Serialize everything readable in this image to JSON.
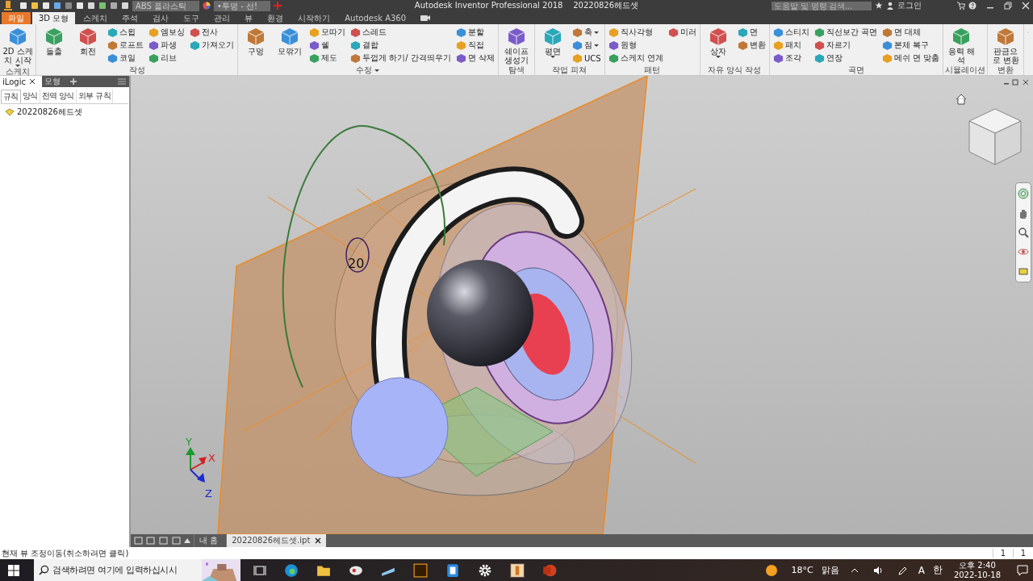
{
  "title_bar": {
    "material": "ABS 플라스틱",
    "appearance": "•투명 - 선!",
    "title": "Autodesk Inventor Professional 2018",
    "document": "20220826헤드셋",
    "search": {
      "placeholder": "도움말 및 명령 검색..."
    },
    "login": "로그인"
  },
  "tabs": [
    {
      "label": "파일",
      "kind": "file",
      "selected": false
    },
    {
      "label": "3D 모형",
      "kind": "tab",
      "selected": true
    },
    {
      "label": "스케치",
      "kind": "tab",
      "selected": false
    },
    {
      "label": "주석",
      "kind": "tab",
      "selected": false
    },
    {
      "label": "검사",
      "kind": "tab",
      "selected": false
    },
    {
      "label": "도구",
      "kind": "tab",
      "selected": false
    },
    {
      "label": "관리",
      "kind": "tab",
      "selected": false
    },
    {
      "label": "뷰",
      "kind": "tab",
      "selected": false
    },
    {
      "label": "환경",
      "kind": "tab",
      "selected": false
    },
    {
      "label": "시작하기",
      "kind": "tab",
      "selected": false
    },
    {
      "label": "Autodesk A360",
      "kind": "tab",
      "selected": false
    }
  ],
  "ribbon": [
    {
      "title": "스케치",
      "items": [
        {
          "label": "2D 스케치 시작",
          "kind": "large",
          "dropdown": true
        }
      ]
    },
    {
      "title": "작성",
      "items": [
        {
          "label": "돌출",
          "kind": "large"
        },
        {
          "label": "회전",
          "kind": "large"
        },
        {
          "label": "스윕",
          "kind": "small"
        },
        {
          "label": "로프트",
          "kind": "small"
        },
        {
          "label": "코일",
          "kind": "small"
        },
        {
          "label": "엠보싱",
          "kind": "small"
        },
        {
          "label": "파생",
          "kind": "small"
        },
        {
          "label": "리브",
          "kind": "small"
        },
        {
          "label": "전사",
          "kind": "small"
        },
        {
          "label": "가져오기",
          "kind": "small"
        }
      ]
    },
    {
      "title": "수정",
      "expandable": true,
      "items": [
        {
          "label": "구멍",
          "kind": "large"
        },
        {
          "label": "모깎기",
          "kind": "large"
        },
        {
          "label": "모따기",
          "kind": "small"
        },
        {
          "label": "쉘",
          "kind": "small"
        },
        {
          "label": "제도",
          "kind": "small"
        },
        {
          "label": "스레드",
          "kind": "small"
        },
        {
          "label": "결합",
          "kind": "small"
        },
        {
          "label": "두껍게 하기/ 간격띄우기",
          "kind": "small"
        },
        {
          "label": "분할",
          "kind": "small"
        },
        {
          "label": "직접",
          "kind": "small"
        },
        {
          "label": "면 삭제",
          "kind": "small"
        }
      ]
    },
    {
      "title": "탐색",
      "items": [
        {
          "label": "쉐이프 생성기",
          "kind": "large"
        }
      ]
    },
    {
      "title": "작업 피쳐",
      "items": [
        {
          "label": "평면",
          "kind": "large",
          "dropdown": true
        },
        {
          "label": "축",
          "kind": "small",
          "dropdown": true
        },
        {
          "label": "점",
          "kind": "small",
          "dropdown": true
        },
        {
          "label": "UCS",
          "kind": "small"
        }
      ]
    },
    {
      "title": "패턴",
      "items": [
        {
          "label": "직사각형",
          "kind": "small"
        },
        {
          "label": "원형",
          "kind": "small"
        },
        {
          "label": "스케치 연계",
          "kind": "small"
        },
        {
          "label": "미러",
          "kind": "small"
        }
      ]
    },
    {
      "title": "자유 양식 작성",
      "items": [
        {
          "label": "상자",
          "kind": "large",
          "dropdown": true
        },
        {
          "label": "면",
          "kind": "small"
        },
        {
          "label": "변환",
          "kind": "small"
        }
      ]
    },
    {
      "title": "곡면",
      "items": [
        {
          "label": "스티치",
          "kind": "small"
        },
        {
          "label": "패치",
          "kind": "small"
        },
        {
          "label": "조각",
          "kind": "small"
        },
        {
          "label": "직선보간 곡면",
          "kind": "small"
        },
        {
          "label": "자르기",
          "kind": "small"
        },
        {
          "label": "연장",
          "kind": "small"
        },
        {
          "label": "면 대체",
          "kind": "small"
        },
        {
          "label": "본체 복구",
          "kind": "small"
        },
        {
          "label": "메쉬 면 맞춤",
          "kind": "small"
        }
      ]
    },
    {
      "title": "시뮬레이션",
      "items": [
        {
          "label": "응력 해석",
          "kind": "large"
        }
      ]
    },
    {
      "title": "변환",
      "items": [
        {
          "label": "판금으로 변환",
          "kind": "large"
        }
      ]
    }
  ],
  "browser": {
    "tabs": [
      {
        "label": "iLogic",
        "selected": true,
        "closable": true
      },
      {
        "label": "모형",
        "selected": false
      }
    ],
    "subtabs": [
      {
        "label": "규칙",
        "selected": true
      },
      {
        "label": "양식",
        "selected": false
      },
      {
        "label": "전역 양식",
        "selected": false
      },
      {
        "label": "외부 규칙",
        "selected": false
      }
    ],
    "tree": [
      {
        "label": "20220826헤드셋"
      }
    ]
  },
  "viewport": {
    "dimension": "20",
    "axes": [
      {
        "label": "Y",
        "color": "#1a9a2a"
      },
      {
        "label": "X",
        "color": "#d42020"
      },
      {
        "label": "Z",
        "color": "#1a2ad0"
      }
    ]
  },
  "document_tabs": [
    {
      "label": "내 홈",
      "selected": false
    },
    {
      "label": "20220826헤드셋.ipt",
      "selected": true,
      "closable": true
    }
  ],
  "status_bar": {
    "message": "현재 뷰 조정이동(취소하려면 클릭)",
    "cells": [
      "1",
      "1"
    ]
  },
  "taskbar": {
    "search": {
      "placeholder": "검색하려면 여기에 입력하십시시"
    },
    "weather": {
      "temperature": "18°C",
      "condition": "맑음"
    },
    "tray": [
      "A",
      "한"
    ],
    "time": "오후 2:40",
    "date": "2022-10-18"
  }
}
